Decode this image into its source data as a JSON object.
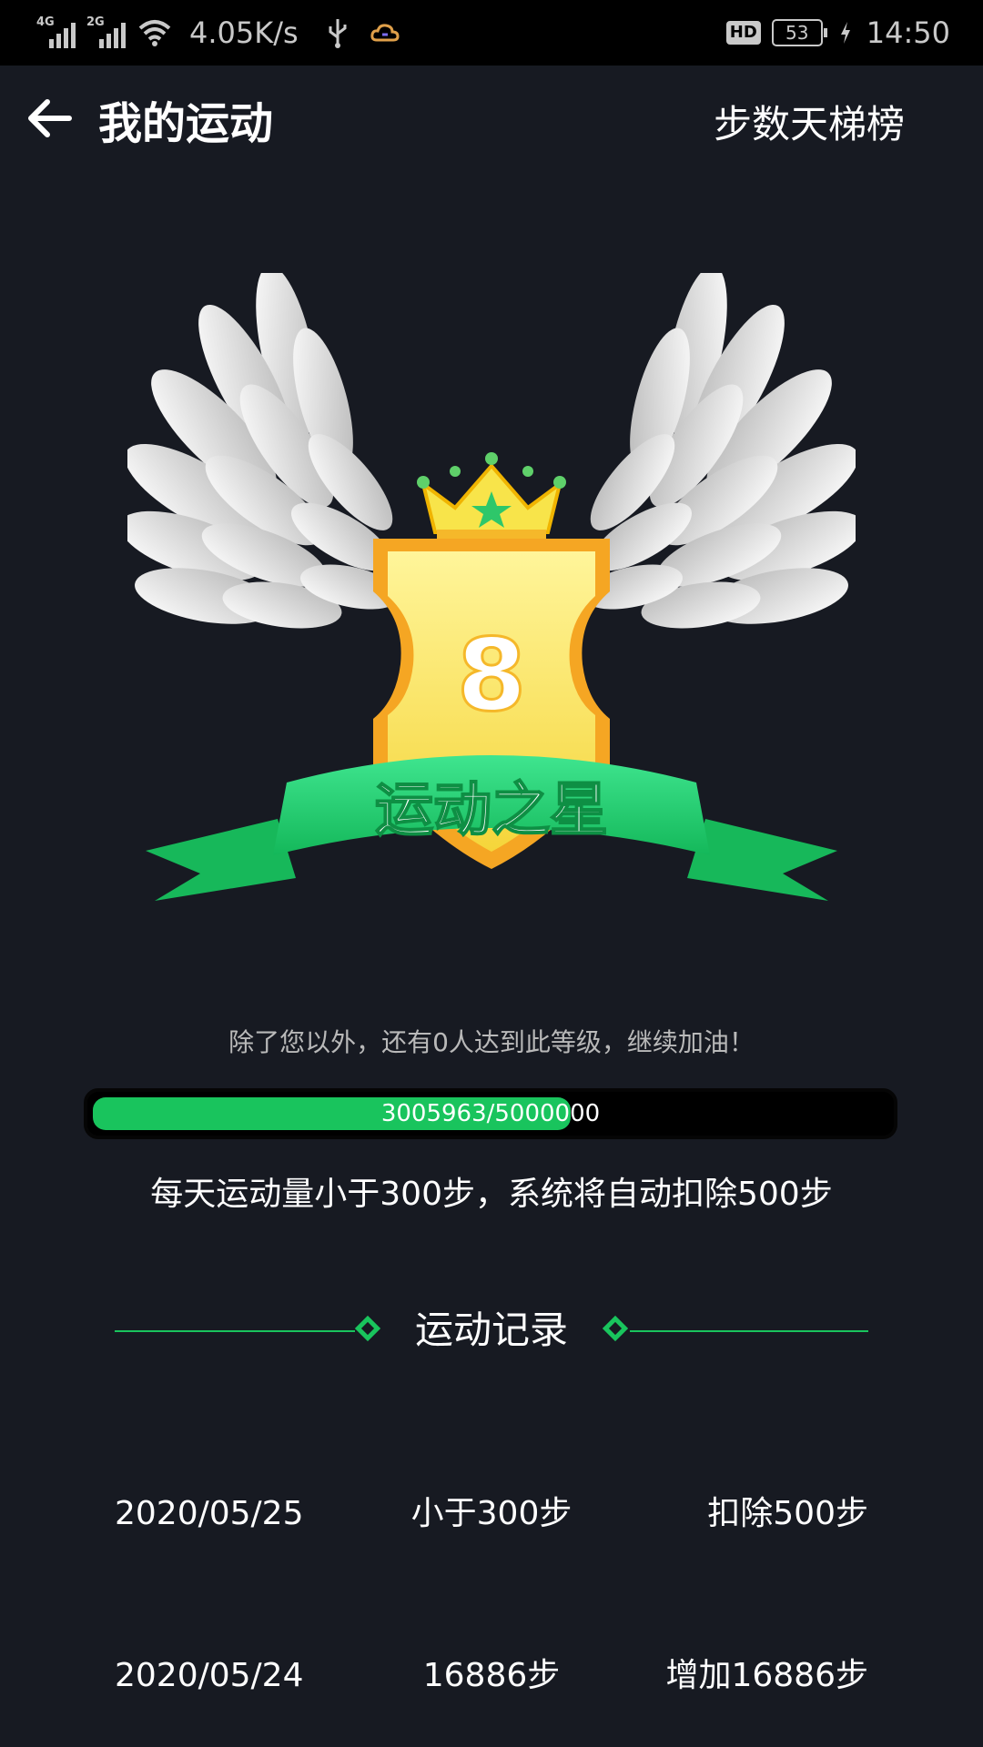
{
  "status_bar": {
    "signal1_label": "4G",
    "signal2_label": "2G",
    "net_speed": "4.05K/s",
    "hd": "HD",
    "battery": "53",
    "time": "14:50"
  },
  "header": {
    "title": "我的运动",
    "ladder_link": "步数天梯榜"
  },
  "badge": {
    "level": "8",
    "ribbon_text": "运动之星"
  },
  "info": {
    "message": "除了您以外，还有0人达到此等级，继续加油！",
    "progress_text": "3005963/5000000",
    "progress_fraction": 0.601,
    "rule": "每天运动量小于300步，系统将自动扣除500步"
  },
  "records_section": {
    "title": "运动记录"
  },
  "records": [
    {
      "date": "2020/05/25",
      "steps": "小于300步",
      "change": "扣除500步"
    },
    {
      "date": "2020/05/24",
      "steps": "16886步",
      "change": "增加16886步"
    }
  ],
  "colors": {
    "background": "#171a22",
    "accent_green": "#19c45d",
    "gold": "#f5b82a"
  }
}
